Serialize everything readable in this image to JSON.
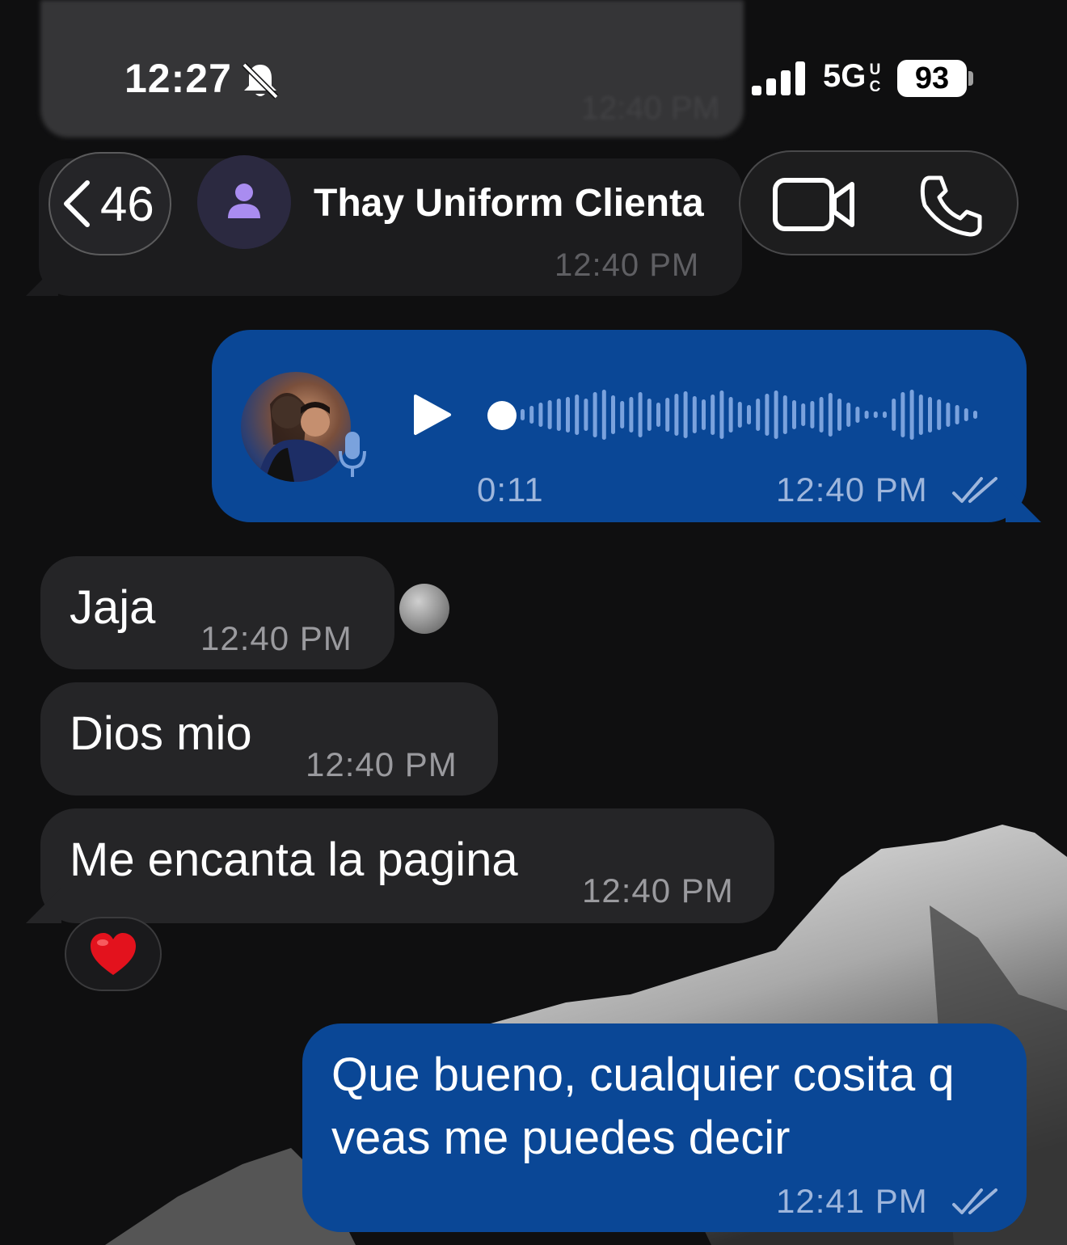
{
  "status_bar": {
    "time": "12:27",
    "network": "5G",
    "network_sup": "UC",
    "battery": "93",
    "icons": [
      "bell-slash-icon",
      "signal-bars-icon"
    ]
  },
  "header": {
    "back_count": "46",
    "contact_name": "Thay Uniform Clienta",
    "icons": [
      "chevron-left-icon",
      "person-icon",
      "video-camera-icon",
      "phone-icon"
    ]
  },
  "background_message": {
    "top_time": "12:40 PM",
    "time": "12:40 PM"
  },
  "messages": [
    {
      "kind": "voice",
      "direction": "outgoing",
      "duration": "0:11",
      "time": "12:40 PM",
      "status": "read"
    },
    {
      "kind": "text",
      "direction": "incoming",
      "text": "Jaja",
      "time": "12:40 PM"
    },
    {
      "kind": "text",
      "direction": "incoming",
      "text": "Dios mio",
      "time": "12:40 PM"
    },
    {
      "kind": "text",
      "direction": "incoming",
      "text": "Me encanta la pagina",
      "time": "12:40 PM",
      "reaction": "❤️"
    },
    {
      "kind": "text",
      "direction": "outgoing",
      "text_line1": "Que bueno, cualquier cosita q",
      "text_line2": "veas me puedes decir",
      "time": "12:41 PM",
      "status": "read"
    }
  ],
  "colors": {
    "outgoing_bubble": "#0a4796",
    "incoming_bubble": "#252527",
    "background": "#0f0f10",
    "outgoing_meta": "#9eb6dc",
    "incoming_meta": "#9a9a9e"
  }
}
